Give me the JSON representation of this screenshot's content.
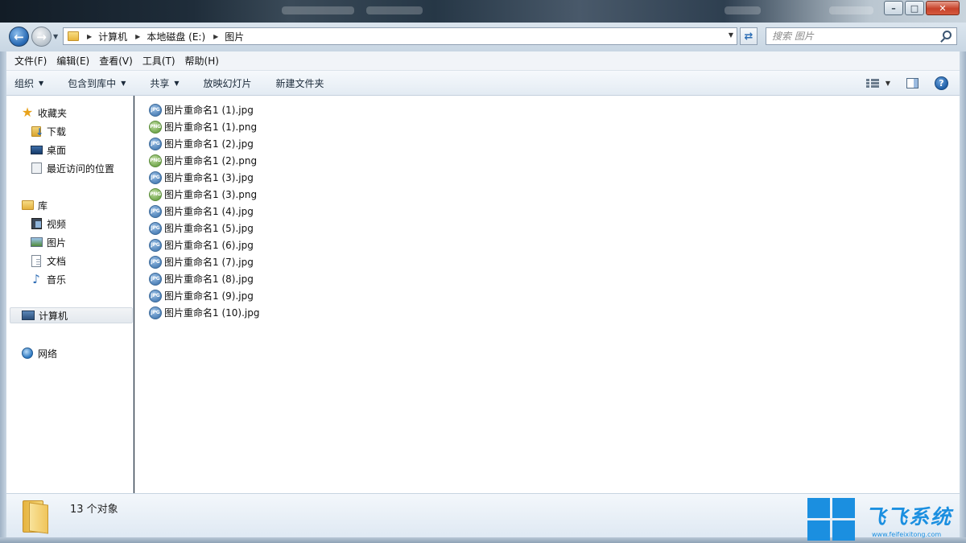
{
  "window": {
    "controls": {
      "minimize": "–",
      "maximize": "□",
      "close": "✕"
    }
  },
  "address": {
    "breadcrumbs": [
      "计算机",
      "本地磁盘 (E:)",
      "图片"
    ]
  },
  "search": {
    "placeholder": "搜索 图片"
  },
  "menu": [
    "文件(F)",
    "编辑(E)",
    "查看(V)",
    "工具(T)",
    "帮助(H)"
  ],
  "commands": {
    "organize": "组织",
    "include_library": "包含到库中",
    "share": "共享",
    "slideshow": "放映幻灯片",
    "new_folder": "新建文件夹"
  },
  "sidebar": {
    "favorites": {
      "label": "收藏夹",
      "items": [
        "下载",
        "桌面",
        "最近访问的位置"
      ]
    },
    "libraries": {
      "label": "库",
      "items": [
        "视频",
        "图片",
        "文档",
        "音乐"
      ]
    },
    "computer": "计算机",
    "network": "网络"
  },
  "files": [
    {
      "name": "图片重命名1 (1).jpg",
      "type": "jpg"
    },
    {
      "name": "图片重命名1 (1).png",
      "type": "png"
    },
    {
      "name": "图片重命名1 (2).jpg",
      "type": "jpg"
    },
    {
      "name": "图片重命名1 (2).png",
      "type": "png"
    },
    {
      "name": "图片重命名1 (3).jpg",
      "type": "jpg"
    },
    {
      "name": "图片重命名1 (3).png",
      "type": "png"
    },
    {
      "name": "图片重命名1 (4).jpg",
      "type": "jpg"
    },
    {
      "name": "图片重命名1 (5).jpg",
      "type": "jpg"
    },
    {
      "name": "图片重命名1 (6).jpg",
      "type": "jpg"
    },
    {
      "name": "图片重命名1 (7).jpg",
      "type": "jpg"
    },
    {
      "name": "图片重命名1 (8).jpg",
      "type": "jpg"
    },
    {
      "name": "图片重命名1 (9).jpg",
      "type": "jpg"
    },
    {
      "name": "图片重命名1 (10).jpg",
      "type": "jpg"
    }
  ],
  "icon_labels": {
    "jpg": "JPG",
    "png": "PNG"
  },
  "status": {
    "count_text": "13 个对象"
  },
  "watermark": {
    "brand": "飞飞系统",
    "url": "www.feifeixitong.com"
  },
  "colors": {
    "jpg_icon": "#4b7fb6",
    "png_icon": "#6fa54a",
    "watermark": "#1b8fe0"
  }
}
